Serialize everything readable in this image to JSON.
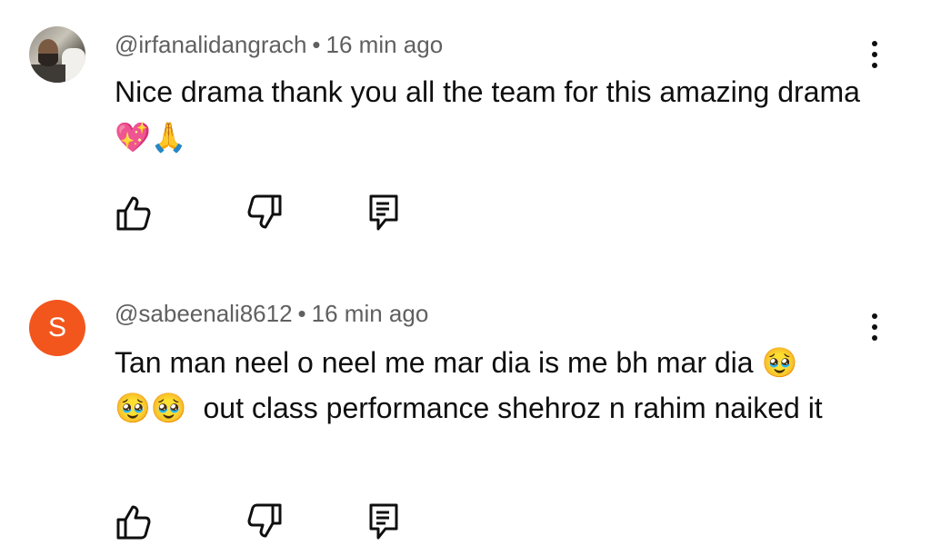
{
  "comments": [
    {
      "author": "@irfanalidangrach",
      "separator": "•",
      "time": "16 min ago",
      "text": "Nice drama thank you all the team for this amazing drama",
      "emojis": "💖🙏",
      "avatar_type": "photo",
      "actions": [
        "like-icon",
        "dislike-icon",
        "reply-icon"
      ]
    },
    {
      "author": "@sabeenali8612",
      "separator": "•",
      "time": "16 min ago",
      "avatar_letter": "S",
      "avatar_color": "#f2561d",
      "text_part1": "Tan man neel o neel me mar dia is me bh mar dia",
      "emoji_inline": "🥹",
      "emoji_line2": "🥹🥹",
      "text_part2": "out class performance shehroz n rahim naiked it",
      "actions": [
        "like-icon",
        "dislike-icon",
        "reply-icon"
      ]
    }
  ],
  "icons": {
    "more": "vertical-dots-icon"
  }
}
